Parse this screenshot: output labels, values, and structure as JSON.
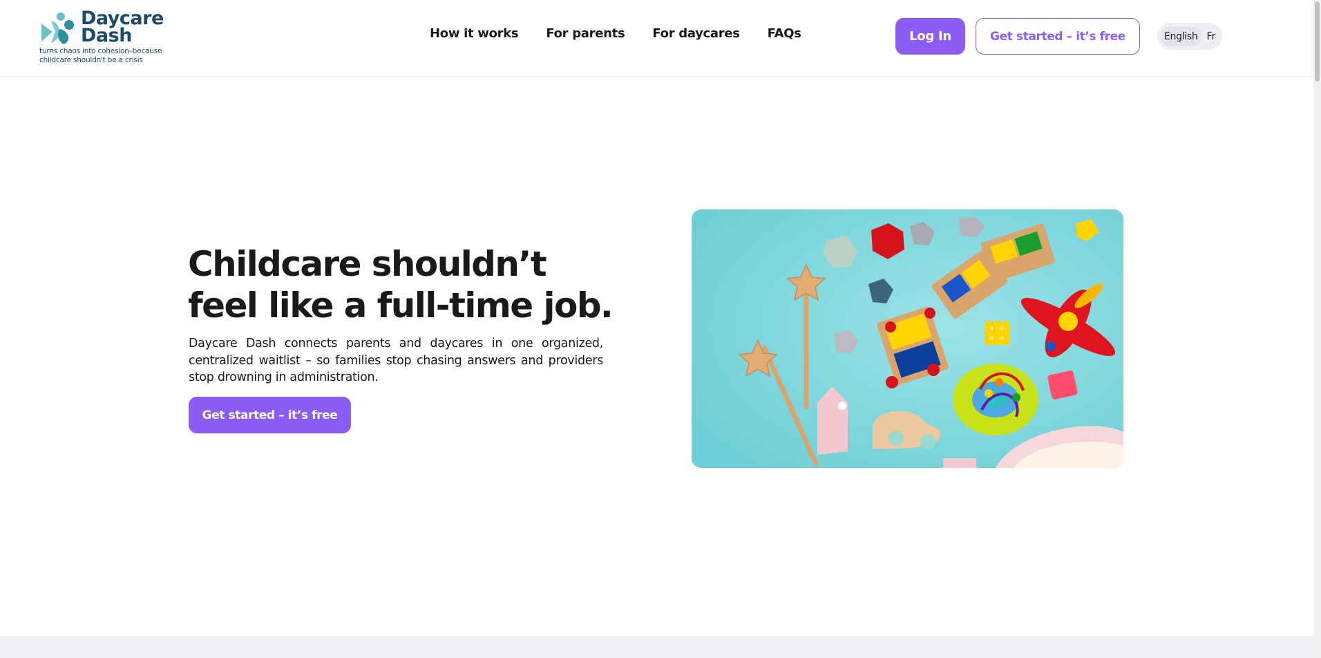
{
  "brand": {
    "name_line1": "Daycare",
    "name_line2": "Dash",
    "tagline": "turns chaos into cohesion–because childcare shouldn't be a crisis",
    "color": "#1d4a66",
    "accent": "#8b5cf6"
  },
  "nav": {
    "items": [
      {
        "label": "How it works"
      },
      {
        "label": "For parents"
      },
      {
        "label": "For daycares"
      },
      {
        "label": "FAQs"
      }
    ]
  },
  "header_actions": {
    "login_label": "Log In",
    "get_started_label": "Get started – it’s free"
  },
  "language": {
    "options": [
      "English",
      "Fr"
    ],
    "selected": "English"
  },
  "hero": {
    "title_line1": "Childcare shouldn’t",
    "title_line2": "feel like a full-time job.",
    "description": "Daycare Dash connects parents and daycares in one organized, centralized waitlist – so families stop chasing answers and providers stop drowning in administration.",
    "cta_label": "Get started – it’s free",
    "image_subject": "colorful wooden toys on a turquoise background"
  }
}
